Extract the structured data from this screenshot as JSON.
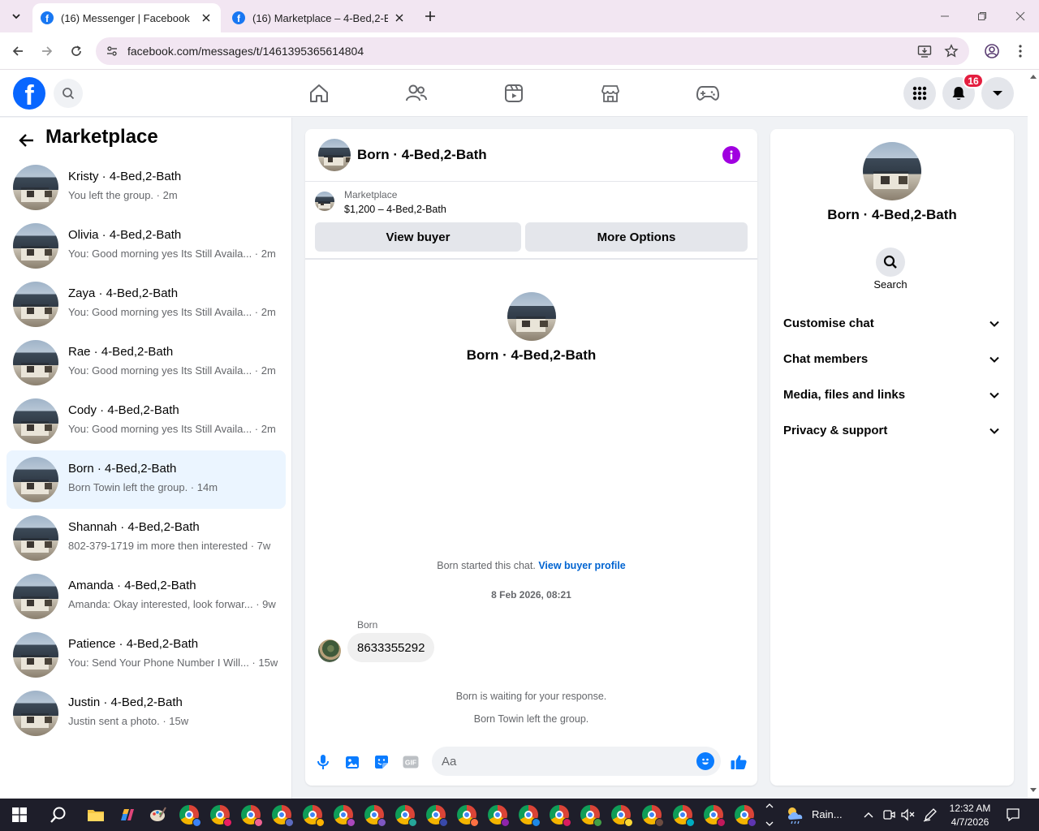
{
  "browser": {
    "tabs": [
      {
        "label": "(16) Messenger | Facebook",
        "active": true
      },
      {
        "label": "(16) Marketplace – 4-Bed,2-Bath",
        "active": false
      }
    ],
    "url": "facebook.com/messages/t/1461395365614804"
  },
  "fb": {
    "notification_count": "16",
    "brand_color": "#0866ff"
  },
  "sidebar": {
    "title": "Marketplace",
    "conversations": [
      {
        "name": "Kristy · 4-Bed,2-Bath",
        "snippet": "You left the group. · 2m"
      },
      {
        "name": "Olivia · 4-Bed,2-Bath",
        "snippet": "You: Good morning yes Its Still Availa... · 2m"
      },
      {
        "name": "Zaya · 4-Bed,2-Bath",
        "snippet": "You: Good morning yes Its Still Availa... · 2m"
      },
      {
        "name": "Rae · 4-Bed,2-Bath",
        "snippet": "You: Good morning yes Its Still Availa... · 2m"
      },
      {
        "name": "Cody · 4-Bed,2-Bath",
        "snippet": "You: Good morning yes Its Still Availa... · 2m"
      },
      {
        "name": "Born · 4-Bed,2-Bath",
        "snippet": "Born Towin left the group. · 14m",
        "selected": true
      },
      {
        "name": "Shannah · 4-Bed,2-Bath",
        "snippet": "802-379-1719 im more then interested · 7w"
      },
      {
        "name": "Amanda · 4-Bed,2-Bath",
        "snippet": "Amanda: Okay interested, look forwar... · 9w"
      },
      {
        "name": "Patience · 4-Bed,2-Bath",
        "snippet": "You: Send Your Phone Number I Will... · 15w"
      },
      {
        "name": "Justin · 4-Bed,2-Bath",
        "snippet": "Justin sent a photo. · 15w"
      }
    ]
  },
  "chat": {
    "title": "Born · 4-Bed,2-Bath",
    "listing_source": "Marketplace",
    "listing_price": "$1,200 – 4-Bed,2-Bath",
    "view_buyer_label": "View buyer",
    "more_options_label": "More Options",
    "intro_name": "Born · 4-Bed,2-Bath",
    "started_text": "Born started this chat.",
    "view_profile_link": "View buyer profile",
    "date_stamp": "8 Feb 2026, 08:21",
    "sender": "Born",
    "message": "8633355292",
    "waiting_text": "Born is waiting for your response.",
    "left_text": "Born Towin left the group.",
    "composer_placeholder": "Aa",
    "accent": "#0a7cff"
  },
  "info": {
    "name": "Born · 4-Bed,2-Bath",
    "search_label": "Search",
    "sections": [
      "Customise chat",
      "Chat members",
      "Media, files and links",
      "Privacy & support"
    ]
  },
  "taskbar": {
    "weather": "Rain...",
    "time": "12:32 AM",
    "date": "4/7/2026"
  }
}
